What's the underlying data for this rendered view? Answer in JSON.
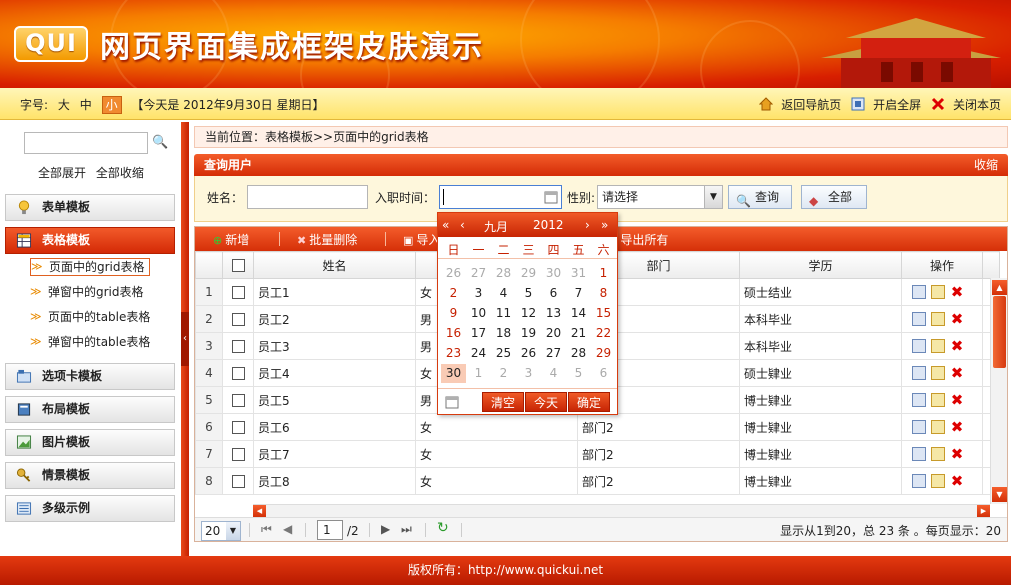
{
  "header": {
    "logo": "QUI",
    "title": "网页界面集成框架皮肤演示"
  },
  "subbar": {
    "font_label": "字号:",
    "font_large": "大",
    "font_medium": "中",
    "font_small": "小",
    "today": "【今天是 2012年9月30日  星期日】",
    "back_nav": "返回导航页",
    "fullscreen": "开启全屏",
    "close_page": "关闭本页"
  },
  "sidebar": {
    "expand_all": "全部展开",
    "collapse_all": "全部收缩",
    "items": [
      {
        "label": "表单模板",
        "icon": "bulb-icon"
      },
      {
        "label": "表格模板",
        "icon": "table-icon",
        "active": true
      },
      {
        "label": "选项卡模板",
        "icon": "tabs-icon"
      },
      {
        "label": "布局模板",
        "icon": "book-icon"
      },
      {
        "label": "图片模板",
        "icon": "image-icon"
      },
      {
        "label": "情景模板",
        "icon": "key-icon"
      },
      {
        "label": "多级示例",
        "icon": "list-icon"
      }
    ],
    "sub_items": [
      "页面中的grid表格",
      "弹窗中的grid表格",
      "页面中的table表格",
      "弹窗中的table表格"
    ]
  },
  "main": {
    "breadcrumb": "当前位置：表格模板>>页面中的grid表格",
    "panel_title": "查询用户",
    "collapse": "收缩",
    "query": {
      "name_label": "姓名：",
      "hire_label": "入职时间：",
      "gender_label": "性别:",
      "gender_value": "请选择",
      "search_btn": "查询",
      "all_btn": "全部"
    }
  },
  "toolbar": {
    "add": "新增",
    "batch_delete": "批量删除",
    "import": "导入",
    "export_all": "导出所有"
  },
  "grid": {
    "columns": [
      "姓名",
      "",
      "部门",
      "学历",
      "操作"
    ],
    "rows": [
      {
        "no": "1",
        "name": "员工1",
        "gender": "女",
        "dept": "",
        "edu": "硕士结业"
      },
      {
        "no": "2",
        "name": "员工2",
        "gender": "男",
        "dept": "",
        "edu": "本科毕业"
      },
      {
        "no": "3",
        "name": "员工3",
        "gender": "男",
        "dept": "",
        "edu": "本科毕业"
      },
      {
        "no": "4",
        "name": "员工4",
        "gender": "女",
        "dept": "",
        "edu": "硕士肄业"
      },
      {
        "no": "5",
        "name": "员工5",
        "gender": "男",
        "dept": "",
        "edu": "博士肄业"
      },
      {
        "no": "6",
        "name": "员工6",
        "gender": "女",
        "dept": "部门2",
        "edu": "博士肄业"
      },
      {
        "no": "7",
        "name": "员工7",
        "gender": "女",
        "dept": "部门2",
        "edu": "博士肄业"
      },
      {
        "no": "8",
        "name": "员工8",
        "gender": "女",
        "dept": "部门2",
        "edu": "博士肄业"
      }
    ]
  },
  "pager": {
    "page_size": "20",
    "current_page": "1",
    "total_pages": "/2",
    "summary": "显示从1到20，总 23 条 。每页显示：20"
  },
  "calendar": {
    "month": "九月",
    "year": "2012",
    "weekdays": [
      "日",
      "一",
      "二",
      "三",
      "四",
      "五",
      "六"
    ],
    "days": [
      [
        "26",
        "27",
        "28",
        "29",
        "30",
        "31",
        "1"
      ],
      [
        "2",
        "3",
        "4",
        "5",
        "6",
        "7",
        "8"
      ],
      [
        "9",
        "10",
        "11",
        "12",
        "13",
        "14",
        "15"
      ],
      [
        "16",
        "17",
        "18",
        "19",
        "20",
        "21",
        "22"
      ],
      [
        "23",
        "24",
        "25",
        "26",
        "27",
        "28",
        "29"
      ],
      [
        "30",
        "1",
        "2",
        "3",
        "4",
        "5",
        "6"
      ]
    ],
    "clear": "清空",
    "today": "今天",
    "ok": "确定"
  },
  "footer": "版权所有：http://www.quickui.net",
  "colors": {
    "accent": "#d42c06",
    "accent_light": "#f35c2a",
    "yellow_bar": "#ffe36a"
  }
}
